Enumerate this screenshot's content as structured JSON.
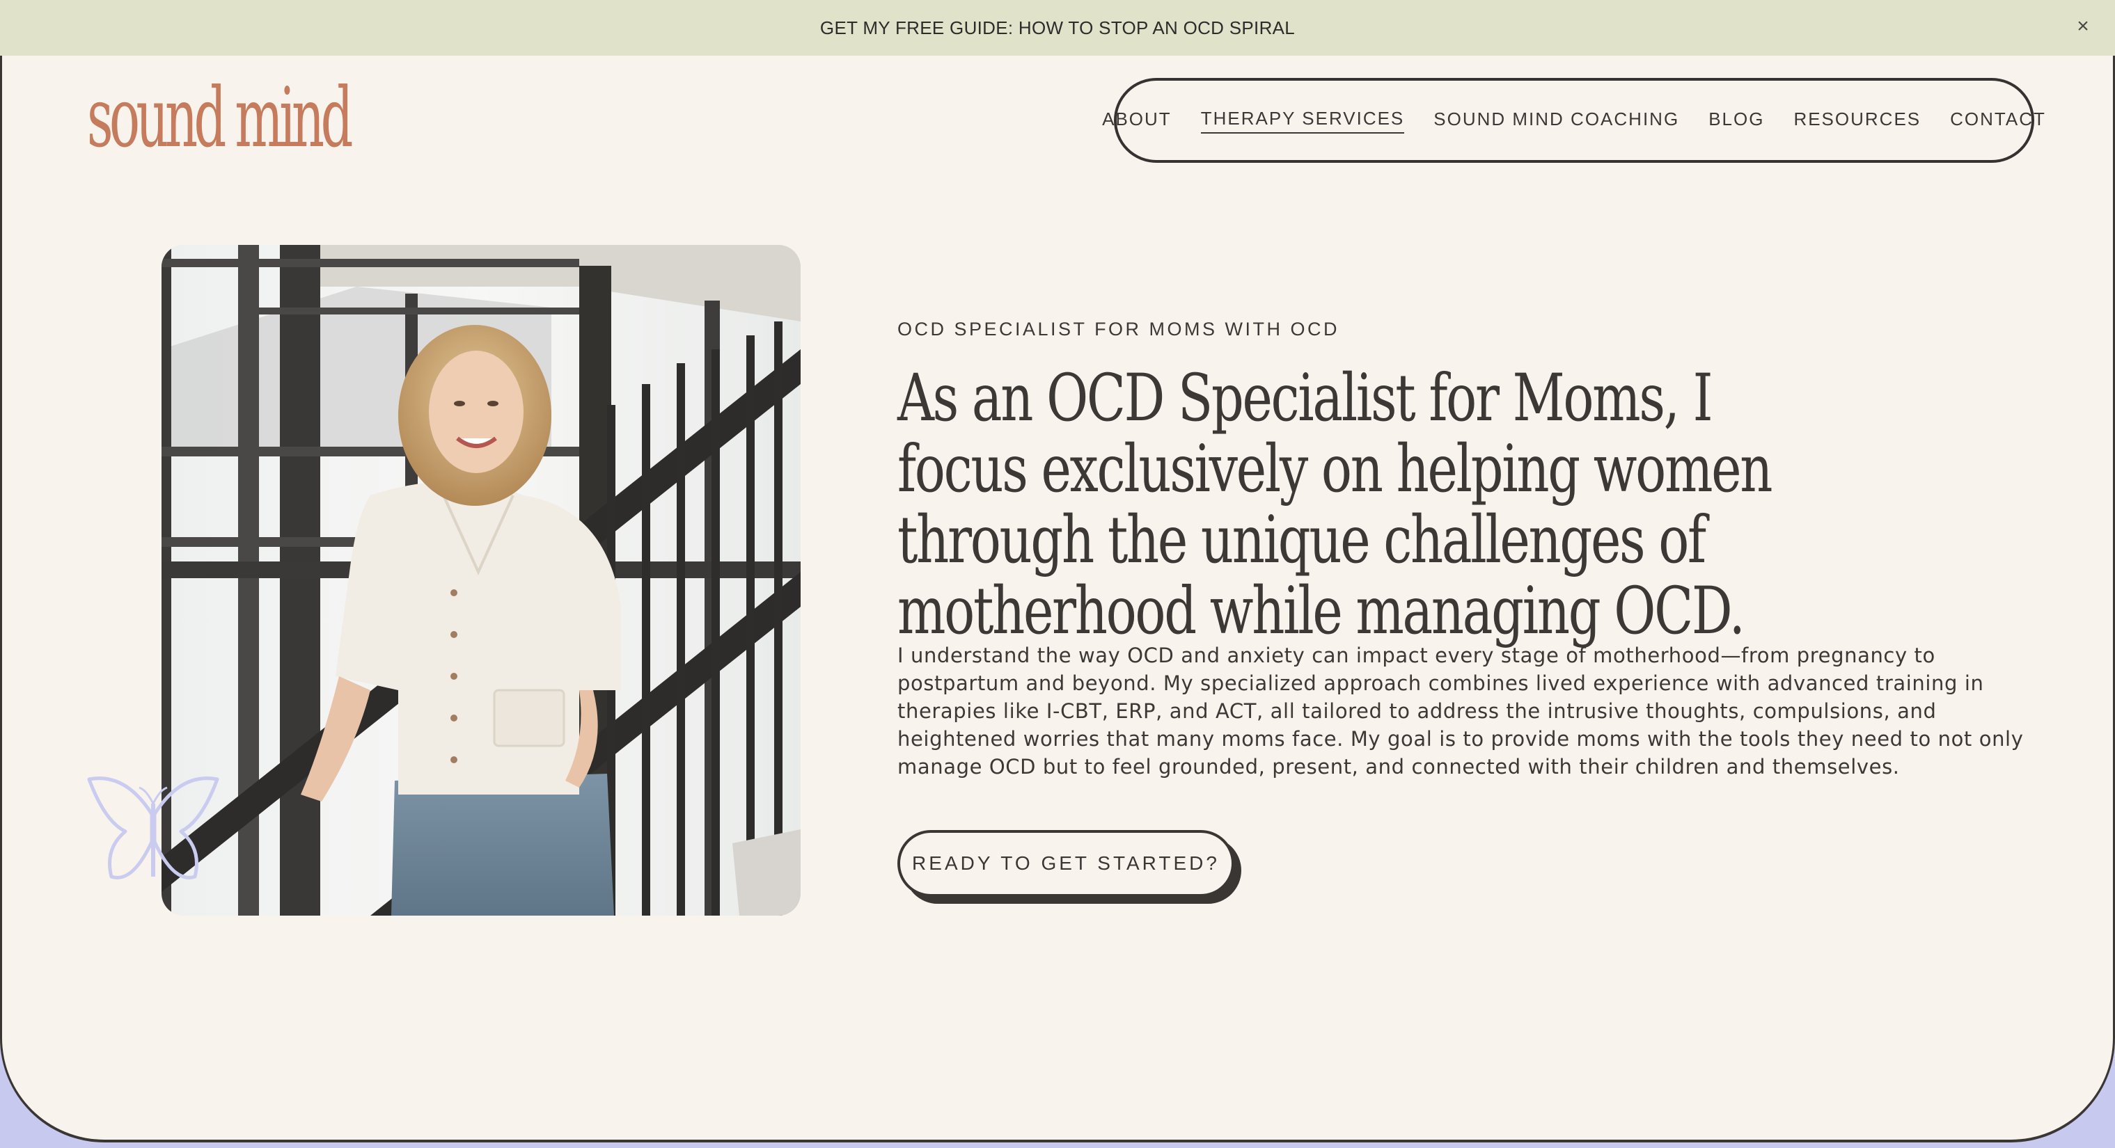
{
  "announcement": {
    "text": "GET MY FREE GUIDE: HOW TO STOP AN OCD SPIRAL",
    "close_symbol": "×"
  },
  "header": {
    "logo_text": "sound mind",
    "logo_color": "#c57b5c",
    "nav": [
      {
        "label": "ABOUT",
        "active": false
      },
      {
        "label": "THERAPY SERVICES",
        "active": true
      },
      {
        "label": "SOUND MIND COACHING",
        "active": false
      },
      {
        "label": "BLOG",
        "active": false
      },
      {
        "label": "RESOURCES",
        "active": false
      },
      {
        "label": "CONTACT",
        "active": false
      }
    ]
  },
  "hero": {
    "eyebrow": "OCD SPECIALIST FOR MOMS WITH OCD",
    "headline": "As an OCD Specialist for Moms, I focus exclusively on helping women through the unique challenges of motherhood while managing OCD.",
    "body": "I understand the way OCD and anxiety can impact every stage of motherhood—from pregnancy to postpartum and beyond. My specialized approach combines lived experience with advanced training in therapies like I-CBT, ERP, and ACT, all tailored to address the intrusive thoughts, compulsions, and heightened worries that many moms face. My goal is to provide moms with the tools they need to not only manage OCD but to feel grounded, present, and connected with their children and themselves.",
    "cta_label": "READY TO GET STARTED?",
    "image_icon": "portrait-photo",
    "decoration_icon": "butterfly-icon"
  },
  "colors": {
    "announce_bg": "#e0e3ca",
    "page_bg": "#f8f4ed",
    "footer_strip": "#c8c9ee",
    "ink": "#3a3634",
    "butterfly": "#c9cbef"
  }
}
